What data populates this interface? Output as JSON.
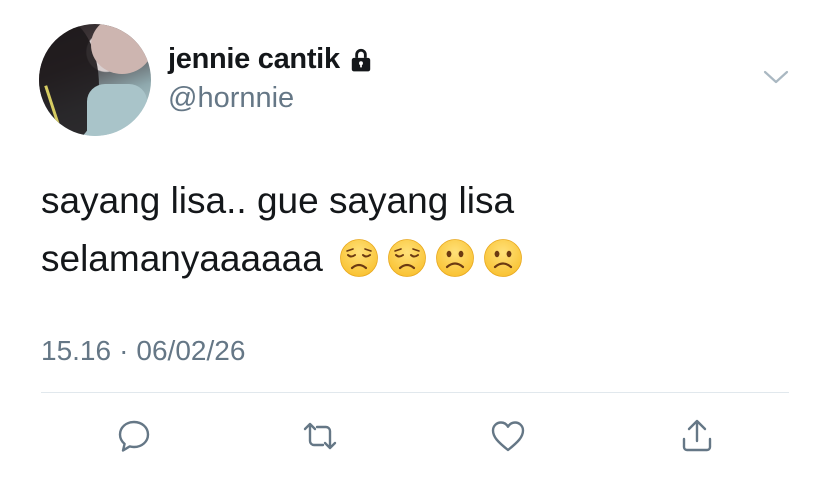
{
  "user": {
    "display_name": "jennie cantik",
    "handle": "@hornnie",
    "protected_icon": "lock-icon"
  },
  "tweet": {
    "text": "sayang lisa.. gue sayang lisa\nselamanyaaaaaa",
    "emojis": [
      "disappointed-face",
      "disappointed-face",
      "frowning-face",
      "frowning-face"
    ],
    "time": "15.16",
    "separator": "·",
    "date": "06/02/26"
  },
  "actions": [
    "reply-icon",
    "retweet-icon",
    "like-icon",
    "share-icon"
  ],
  "colors": {
    "text": "#14171a",
    "secondary": "#657786",
    "divider": "#e1e8ed",
    "emoji": "#f9c232"
  }
}
